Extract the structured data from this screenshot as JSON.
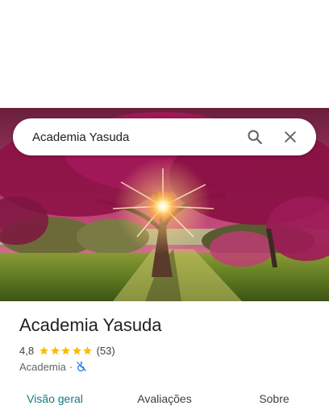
{
  "search": {
    "query": "Academia Yasuda",
    "search_icon": "search-icon",
    "close_icon": "close-icon"
  },
  "hero_photo": {
    "description_icon": "photo",
    "accent": "#b01e5e"
  },
  "place": {
    "name": "Academia Yasuda",
    "rating": "4,8",
    "stars": 5,
    "review_count": "(53)",
    "category": "Academia",
    "separator": "·",
    "accessibility_icon": "no-wheelchair-icon"
  },
  "tabs": [
    {
      "label": "Visão geral",
      "active": true
    },
    {
      "label": "Avaliações",
      "active": false
    },
    {
      "label": "Sobre",
      "active": false
    }
  ],
  "colors": {
    "star": "#fbbc04",
    "active_tab": "#137a7f",
    "access_icon": "#1a73e8"
  }
}
